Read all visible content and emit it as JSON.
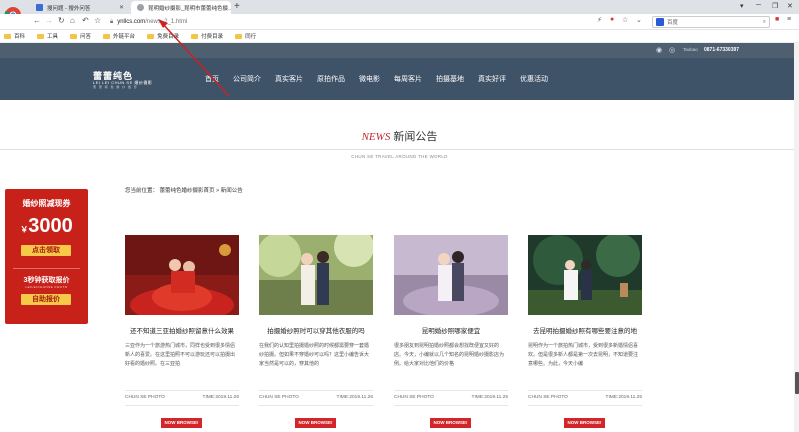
{
  "browser": {
    "tabs": [
      {
        "label": "搜问题 - 搜外问答",
        "active": false
      },
      {
        "label": "昆明婚纱摄影_昆明市蕾蕾纯色摄…",
        "active": true
      }
    ],
    "url_host": "ynllcs.com",
    "url_path": "/news_2_1.html",
    "search_placeholder": "百度",
    "bookmarks": [
      "百科",
      "工具",
      "问答",
      "外链平台",
      "免费目录",
      "付费目录",
      "同行"
    ]
  },
  "site": {
    "taobao": "Taobao",
    "phone": "0871-67330397",
    "logo_main": "蕾蕾纯色",
    "logo_sub": "LEI LEI CHUN SE 婚纱摄影",
    "logo_sub2": "蕾 蕾 纯 色 婚 纱 摄 影",
    "nav": [
      "首页",
      "公司简介",
      "真实客片",
      "原拍作品",
      "微电影",
      "每周客片",
      "拍摄基地",
      "真实好评",
      "优惠活动"
    ],
    "section_title_en": "NEWS",
    "section_title_cn": "新闻公告",
    "section_subtitle": "CHUN SE TRAVEL AROUND THE WORLD",
    "breadcrumb": "您当前位置： 蕾蕾纯色婚纱摄影首页 > 新闻公告"
  },
  "promo": {
    "title": "婚纱照减现券",
    "currency": "￥",
    "amount": "3000",
    "btn1": "点击领取",
    "sec_text": "3秒钟获取报价",
    "sec_en": "LEILEICHUNSE PHOTO",
    "btn2": "自助报价"
  },
  "cards": [
    {
      "title": "还不知道三亚拍婚纱照留意什么效果",
      "excerpt": "三亚作为一个旅游热门城市，同样也受到很多情侣新人的喜爱。在这里拍照不可以游玩还可以拍摄出好看的婚纱照。在三亚拍",
      "source": "CHUN SE PHOTO",
      "time": "TIME:2019.11.26",
      "browse": "NOW BROWSE!"
    },
    {
      "title": "拍摄婚纱照时可以穿其他衣服的吗",
      "excerpt": "在我们的认知里拍摄婚纱照的时候都需要穿一套婚纱拍摄。但如果不穿婚纱可以吗？这里小编告诉大家当然是可以的，穿其他的",
      "source": "CHUN SE PHOTO",
      "time": "TIME:2019.11.26",
      "browse": "NOW BROWSE!"
    },
    {
      "title": "昆明婚纱照哪家便宜",
      "excerpt": "很多朋友到昆明拍婚纱照都会想找既便宜又好的店。今天，小编就以几个知名的昆明婚纱摄影店为例。给大家对比他们的价格",
      "source": "CHUN SE PHOTO",
      "time": "TIME:2019.11.25",
      "browse": "NOW BROWSE!"
    },
    {
      "title": "去昆明拍摄婚纱照有哪些要注意的地",
      "excerpt": "昆明作为一个旅拍热门城市，受到很多新婚情侣喜欢。但是很多新人都是第一次去昆明，不知道要注意哪些。为此，今天小编",
      "source": "CHUN SE PHOTO",
      "time": "TIME:2019.11.25",
      "browse": "NOW BROWSE!"
    }
  ],
  "colors": {
    "nav_bg": "#3e5268",
    "accent_red": "#c0262b",
    "promo_red": "#c8211a",
    "promo_yellow": "#f7c948"
  }
}
